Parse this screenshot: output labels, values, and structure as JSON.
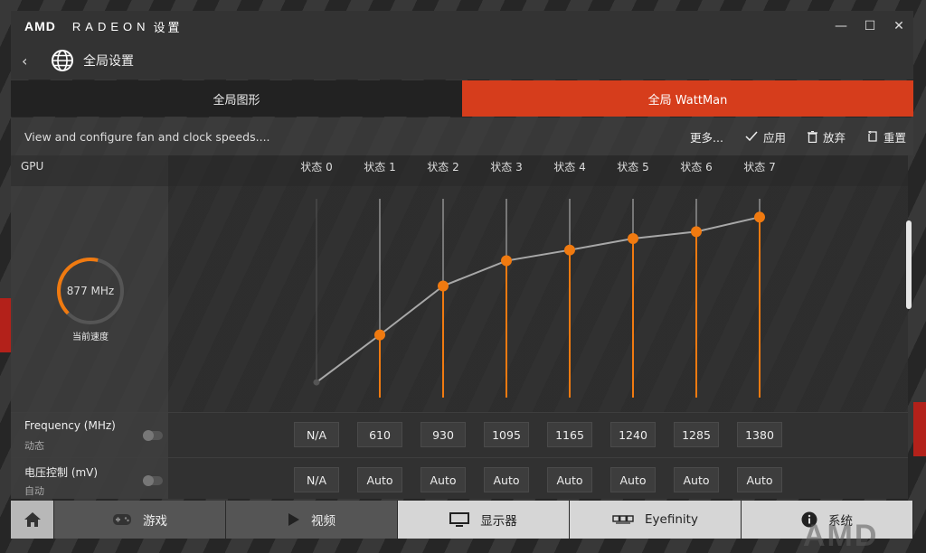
{
  "window": {
    "brand": "AMD",
    "product": "RADEON",
    "product_sub": "设置",
    "min": "—",
    "max": "☐",
    "close": "✕"
  },
  "header": {
    "back": "‹",
    "title": "全局设置"
  },
  "tabs": [
    {
      "label": "全局图形",
      "active": false
    },
    {
      "label": "全局 WattMan",
      "active": true
    }
  ],
  "toolbar": {
    "description": "View and configure fan and clock speeds....",
    "more": "更多...",
    "apply": "应用",
    "discard": "放弃",
    "reset": "重置"
  },
  "gpu": {
    "section_label": "GPU",
    "current_speed": "877 MHz",
    "current_speed_label": "当前速度",
    "gauge_fraction": 0.55
  },
  "states": [
    "状态 0",
    "状态 1",
    "状态 2",
    "状态 3",
    "状态 4",
    "状态 5",
    "状态 6",
    "状态 7"
  ],
  "frequency_row": {
    "title": "Frequency (MHz)",
    "subtitle": "动态",
    "values": [
      "N/A",
      "610",
      "930",
      "1095",
      "1165",
      "1240",
      "1285",
      "1380"
    ]
  },
  "voltage_row": {
    "title": "电压控制 (mV)",
    "subtitle": "自动",
    "values": [
      "N/A",
      "Auto",
      "Auto",
      "Auto",
      "Auto",
      "Auto",
      "Auto",
      "Auto"
    ]
  },
  "chart_data": {
    "type": "line",
    "categories": [
      "状态 0",
      "状态 1",
      "状态 2",
      "状态 3",
      "状态 4",
      "状态 5",
      "状态 6",
      "状态 7"
    ],
    "values": [
      300,
      610,
      930,
      1095,
      1165,
      1240,
      1285,
      1380
    ],
    "ylim": [
      200,
      1500
    ]
  },
  "bottom_nav": {
    "home": "home",
    "items": [
      {
        "label": "游戏",
        "icon": "gamepad-icon",
        "active": false
      },
      {
        "label": "视频",
        "icon": "play-icon",
        "active": false
      },
      {
        "label": "显示器",
        "icon": "monitor-icon",
        "active": true
      },
      {
        "label": "Eyefinity",
        "icon": "eyefinity-icon",
        "active": true
      },
      {
        "label": "系统",
        "icon": "info-icon",
        "active": true
      }
    ],
    "watermark": "AMD"
  },
  "colors": {
    "accent": "#d63d1c",
    "orange": "#f07a10"
  }
}
